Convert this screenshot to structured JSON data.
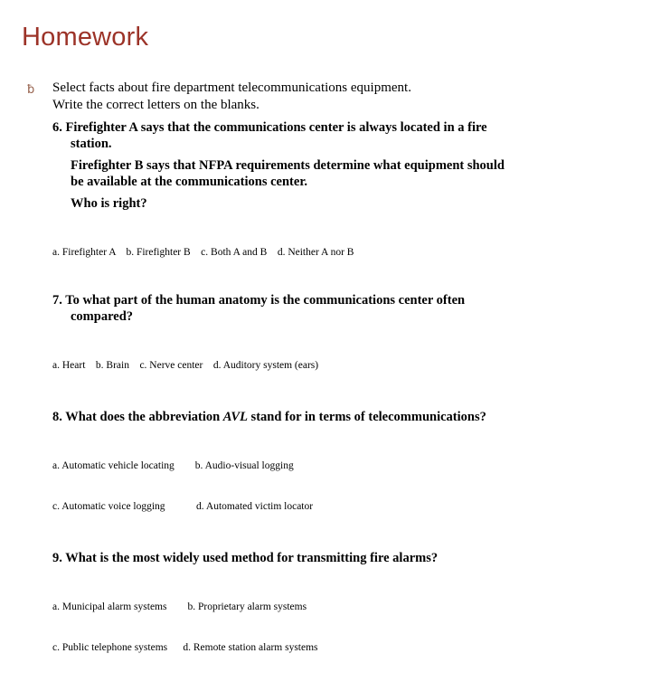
{
  "slide": {
    "title": "Homework",
    "title_color": "#9C3328",
    "background_color": "#FFFFFF"
  },
  "intro": {
    "bullet_glyph": "ƀ",
    "bullet_icon": "wingdings-flourish-bullet",
    "bullet_color": "#96614C",
    "line1": "Select facts about fire department telecommunications equipment.",
    "line2": "Write the correct letters on the blanks."
  },
  "questions": [
    {
      "number": "6.",
      "lines": [
        "6. Firefighter A says that the communications center is always located in a fire",
        "station.",
        "Firefighter B says that NFPA requirements determine what equipment should",
        "be available at the communications center.",
        "Who is right?"
      ],
      "answer_rows": [
        "a. Firefighter A    b. Firefighter B    c. Both A and B    d. Neither A nor B"
      ]
    },
    {
      "number": "7.",
      "lines": [
        "7. To what part of the human anatomy is the communications center often",
        "compared?"
      ],
      "answer_rows": [
        "a. Heart    b. Brain    c. Nerve center    d. Auditory system (ears)"
      ]
    },
    {
      "number": "8.",
      "text_before_italic": "8. What does the abbreviation ",
      "italic_text": "AVL",
      "text_after_italic": " stand for in terms of telecommunications?",
      "answer_rows": [
        "a. Automatic vehicle locating        b. Audio-visual logging",
        "c. Automatic voice logging            d. Automated victim locator"
      ]
    },
    {
      "number": "9.",
      "lines": [
        "9. What is the most widely used method for transmitting fire alarms?"
      ],
      "answer_rows": [
        "a. Municipal alarm systems        b. Proprietary alarm systems",
        "c. Public telephone systems      d. Remote station alarm systems"
      ]
    }
  ]
}
